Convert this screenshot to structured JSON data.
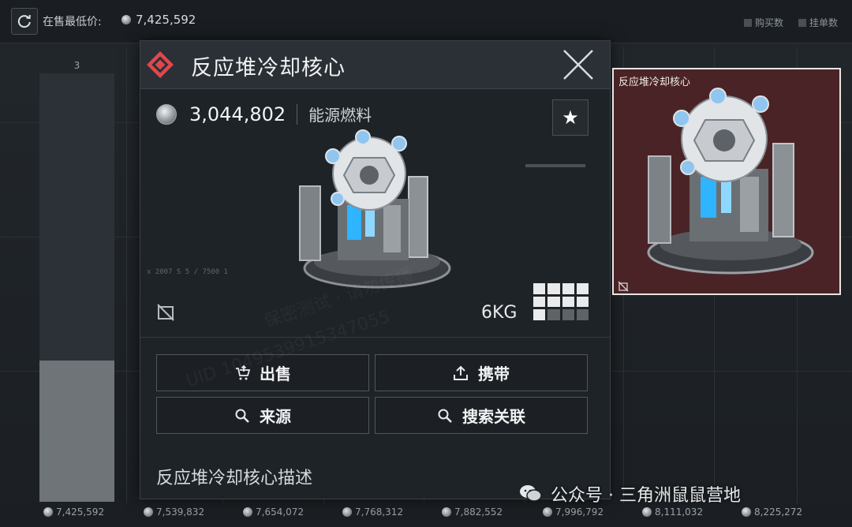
{
  "top_bar": {
    "refresh_icon": "refresh-icon",
    "lowest_price_label": "在售最低价:",
    "lowest_price_value": "7,425,592",
    "legend": [
      "购买数",
      "挂单数"
    ]
  },
  "chart": {
    "bar_count_label": "3",
    "bar_fill_fraction": 0.33,
    "x_ticks": [
      "7,425,592",
      "7,539,832",
      "7,654,072",
      "7,768,312",
      "7,882,552",
      "7,996,792",
      "8,111,032",
      "8,225,272"
    ]
  },
  "popup": {
    "title": "反应堆冷却核心",
    "rarity_color": "#e0474c",
    "price": "3,044,802",
    "category": "能源燃料",
    "weight": "6KG",
    "size_grid_filled": 9,
    "size_grid_total": 12,
    "buttons": {
      "sell": "出售",
      "carry": "携带",
      "source": "来源",
      "search_related": "搜索关联"
    },
    "description_title": "反应堆冷却核心描述",
    "hud_text": "x 2007 S 5 / 7500 1"
  },
  "preview": {
    "title": "反应堆冷却核心",
    "background_color": "#4a2326"
  },
  "watermark": {
    "footer": "公众号 · 三角洲鼠鼠营地",
    "uid_text": "UID 1049539915347055",
    "testing_text": "保密测试 · 请勿传播"
  }
}
